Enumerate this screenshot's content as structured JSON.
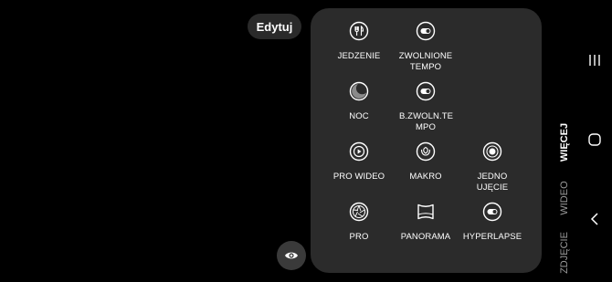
{
  "edit_button": "Edytuj",
  "modes": [
    {
      "label": "JEDZENIE",
      "icon": "fork-knife-icon"
    },
    {
      "label": "ZWOLNIONE TEMPO",
      "icon": "slow-motion-icon"
    },
    {
      "label": "NOC",
      "icon": "moon-icon"
    },
    {
      "label": "B.ZWOLN.TE MPO",
      "icon": "super-slow-motion-icon"
    },
    {
      "label": "PRO WIDEO",
      "icon": "pro-video-icon"
    },
    {
      "label": "MAKRO",
      "icon": "flower-icon"
    },
    {
      "label": "JEDNO UJĘCIE",
      "icon": "single-take-icon"
    },
    {
      "label": "PRO",
      "icon": "aperture-icon"
    },
    {
      "label": "PANORAMA",
      "icon": "panorama-icon"
    },
    {
      "label": "HYPERLAPSE",
      "icon": "hyperlapse-icon"
    }
  ],
  "side_tabs": {
    "more": "WIĘCEJ",
    "video": "WIDEO",
    "photo": "ZDJĘCIE"
  },
  "colors": {
    "background": "#000000",
    "panel": "#2b2b2b",
    "active_tab": "#ffffff",
    "inactive_tab": "#9a9a9a"
  }
}
